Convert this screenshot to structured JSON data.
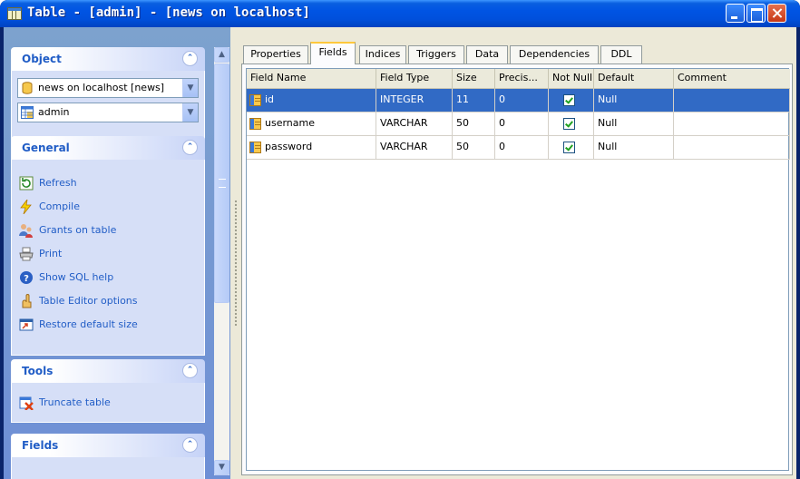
{
  "window": {
    "title": "Table - [admin] - [news on localhost]"
  },
  "sidebar": {
    "object": {
      "heading": "Object",
      "database_combo": "news on localhost [news]",
      "table_combo": "admin"
    },
    "general": {
      "heading": "General",
      "items": [
        {
          "label": "Refresh",
          "icon": "refresh-icon"
        },
        {
          "label": "Compile",
          "icon": "lightning-icon"
        },
        {
          "label": "Grants on table",
          "icon": "grants-icon"
        },
        {
          "label": "Print",
          "icon": "printer-icon"
        },
        {
          "label": "Show SQL help",
          "icon": "help-icon"
        },
        {
          "label": "Table Editor options",
          "icon": "options-icon"
        },
        {
          "label": "Restore default size",
          "icon": "restore-icon"
        }
      ]
    },
    "tools": {
      "heading": "Tools",
      "items": [
        {
          "label": "Truncate table",
          "icon": "truncate-icon"
        }
      ]
    },
    "fields": {
      "heading": "Fields"
    }
  },
  "tabs": [
    "Properties",
    "Fields",
    "Indices",
    "Triggers",
    "Data",
    "Dependencies",
    "DDL"
  ],
  "active_tab": "Fields",
  "grid": {
    "columns": [
      "Field Name",
      "Field Type",
      "Size",
      "Precis...",
      "Not Null",
      "Default",
      "Comment"
    ],
    "rows": [
      {
        "name": "id",
        "type": "INTEGER",
        "size": "11",
        "precision": "0",
        "not_null": true,
        "default": "Null",
        "comment": "",
        "selected": true
      },
      {
        "name": "username",
        "type": "VARCHAR",
        "size": "50",
        "precision": "0",
        "not_null": true,
        "default": "Null",
        "comment": "",
        "selected": false
      },
      {
        "name": "password",
        "type": "VARCHAR",
        "size": "50",
        "precision": "0",
        "not_null": true,
        "default": "Null",
        "comment": "",
        "selected": false
      }
    ]
  },
  "colors": {
    "title_bar": "#0054e3",
    "selection": "#316ac5",
    "link": "#215dc6"
  }
}
